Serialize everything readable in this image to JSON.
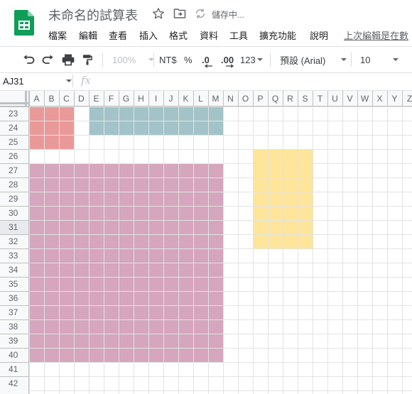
{
  "app": {
    "title": "未命名的試算表",
    "save_status": "儲存中...",
    "icons": {
      "logo": "google-sheets-logo",
      "star": "star-icon",
      "move": "folder-move-icon",
      "sync": "sync-icon"
    }
  },
  "menu": {
    "items": [
      "檔案",
      "編輯",
      "查看",
      "插入",
      "格式",
      "資料",
      "工具",
      "擴充功能",
      "說明"
    ],
    "last_edit": "上次編輯是在數"
  },
  "toolbar": {
    "zoom": "100%",
    "currency": "NT$",
    "percent": "%",
    "decrease_decimal": ".0",
    "increase_decimal": ".00",
    "more_formats": "123",
    "font": "預設 (Arial)",
    "font_size": "10",
    "icons": [
      "undo-icon",
      "redo-icon",
      "print-icon",
      "paint-format-icon"
    ]
  },
  "formula_bar": {
    "name_box": "AJ31",
    "fx": "fx",
    "value": ""
  },
  "sheet": {
    "columns": [
      "A",
      "B",
      "C",
      "D",
      "E",
      "F",
      "G",
      "H",
      "I",
      "J",
      "K",
      "L",
      "M",
      "N",
      "O",
      "P",
      "Q",
      "R",
      "S",
      "T",
      "U",
      "V",
      "W",
      "X",
      "Y",
      "Z"
    ],
    "rows": [
      23,
      24,
      25,
      26,
      27,
      28,
      29,
      30,
      31,
      32,
      33,
      34,
      35,
      36,
      37,
      38,
      39,
      40,
      41,
      42
    ],
    "selected_row": 31,
    "fills": [
      {
        "range": "A23:C25",
        "color": "#ea9999"
      },
      {
        "range": "E23:M24",
        "color": "#a2c4c9"
      },
      {
        "range": "P26:S32",
        "color": "#ffe599"
      },
      {
        "range": "A27:M40",
        "color": "#d5a6bd"
      }
    ],
    "colors": {
      "header_bg": "#f8f9fa",
      "header_text": "#5f6368",
      "grid_line": "#e2e3e3",
      "header_line": "#c0c0c0",
      "selected_header_bg": "#e8eaed"
    }
  }
}
